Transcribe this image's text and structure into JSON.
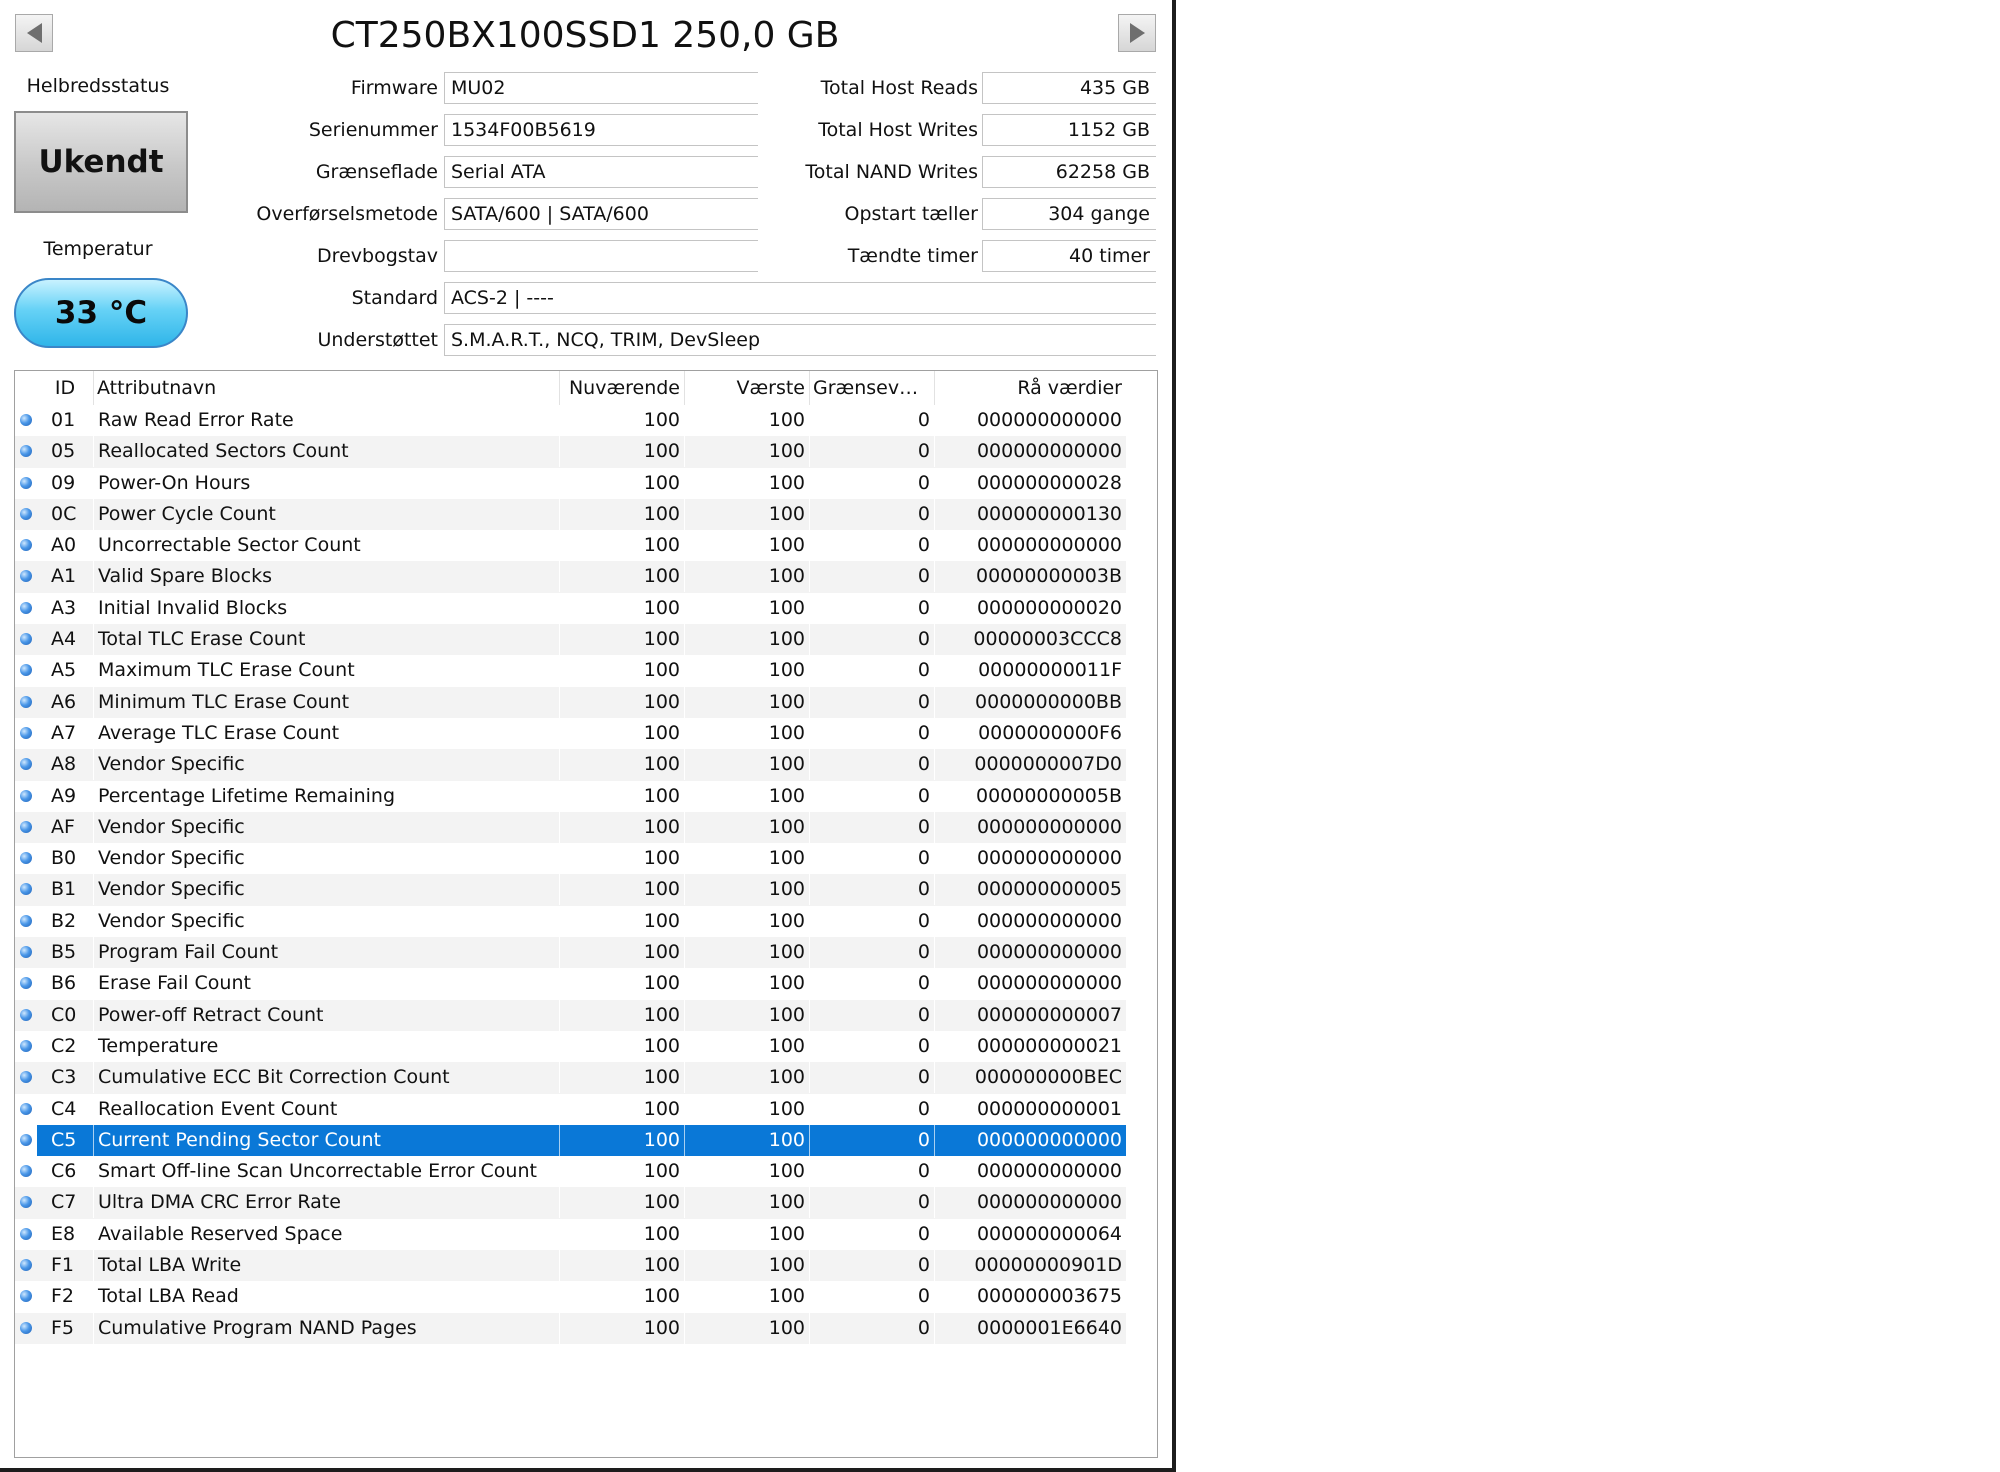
{
  "disk": {
    "title": "CT250BX100SSD1 250,0 GB"
  },
  "status": {
    "health_label": "Helbredsstatus",
    "health_value": "Ukendt",
    "temperature_label": "Temperatur",
    "temperature_value": "33 °C"
  },
  "info_left": [
    {
      "label": "Firmware",
      "value": "MU02"
    },
    {
      "label": "Serienummer",
      "value": "1534F00B5619"
    },
    {
      "label": "Grænseflade",
      "value": "Serial ATA"
    },
    {
      "label": "Overførselsmetode",
      "value": "SATA/600 | SATA/600"
    },
    {
      "label": "Drevbogstav",
      "value": ""
    },
    {
      "label": "Standard",
      "value": "ACS-2 | ----"
    },
    {
      "label": "Understøttet",
      "value": "S.M.A.R.T., NCQ, TRIM, DevSleep"
    }
  ],
  "info_right": [
    {
      "label": "Total Host Reads",
      "value": "435 GB"
    },
    {
      "label": "Total Host Writes",
      "value": "1152 GB"
    },
    {
      "label": "Total NAND Writes",
      "value": "62258 GB"
    },
    {
      "label": "Opstart tæller",
      "value": "304 gange"
    },
    {
      "label": "Tændte timer",
      "value": "40 timer"
    }
  ],
  "table": {
    "headers": {
      "id": "ID",
      "name": "Attributnavn",
      "current": "Nuværende",
      "worst": "Værste",
      "threshold": "Grænseværdi",
      "raw": "Rå værdier"
    },
    "rows": [
      {
        "id": "01",
        "name": "Raw Read Error Rate",
        "current": "100",
        "worst": "100",
        "threshold": "0",
        "raw": "000000000000"
      },
      {
        "id": "05",
        "name": "Reallocated Sectors Count",
        "current": "100",
        "worst": "100",
        "threshold": "0",
        "raw": "000000000000"
      },
      {
        "id": "09",
        "name": "Power-On Hours",
        "current": "100",
        "worst": "100",
        "threshold": "0",
        "raw": "000000000028"
      },
      {
        "id": "0C",
        "name": "Power Cycle Count",
        "current": "100",
        "worst": "100",
        "threshold": "0",
        "raw": "000000000130"
      },
      {
        "id": "A0",
        "name": "Uncorrectable Sector Count",
        "current": "100",
        "worst": "100",
        "threshold": "0",
        "raw": "000000000000"
      },
      {
        "id": "A1",
        "name": "Valid Spare Blocks",
        "current": "100",
        "worst": "100",
        "threshold": "0",
        "raw": "00000000003B"
      },
      {
        "id": "A3",
        "name": "Initial Invalid Blocks",
        "current": "100",
        "worst": "100",
        "threshold": "0",
        "raw": "000000000020"
      },
      {
        "id": "A4",
        "name": "Total TLC Erase Count",
        "current": "100",
        "worst": "100",
        "threshold": "0",
        "raw": "00000003CCC8"
      },
      {
        "id": "A5",
        "name": "Maximum TLC Erase Count",
        "current": "100",
        "worst": "100",
        "threshold": "0",
        "raw": "00000000011F"
      },
      {
        "id": "A6",
        "name": "Minimum TLC Erase Count",
        "current": "100",
        "worst": "100",
        "threshold": "0",
        "raw": "0000000000BB"
      },
      {
        "id": "A7",
        "name": "Average TLC Erase Count",
        "current": "100",
        "worst": "100",
        "threshold": "0",
        "raw": "0000000000F6"
      },
      {
        "id": "A8",
        "name": "Vendor Specific",
        "current": "100",
        "worst": "100",
        "threshold": "0",
        "raw": "0000000007D0"
      },
      {
        "id": "A9",
        "name": "Percentage Lifetime Remaining",
        "current": "100",
        "worst": "100",
        "threshold": "0",
        "raw": "00000000005B"
      },
      {
        "id": "AF",
        "name": "Vendor Specific",
        "current": "100",
        "worst": "100",
        "threshold": "0",
        "raw": "000000000000"
      },
      {
        "id": "B0",
        "name": "Vendor Specific",
        "current": "100",
        "worst": "100",
        "threshold": "0",
        "raw": "000000000000"
      },
      {
        "id": "B1",
        "name": "Vendor Specific",
        "current": "100",
        "worst": "100",
        "threshold": "0",
        "raw": "000000000005"
      },
      {
        "id": "B2",
        "name": "Vendor Specific",
        "current": "100",
        "worst": "100",
        "threshold": "0",
        "raw": "000000000000"
      },
      {
        "id": "B5",
        "name": "Program Fail Count",
        "current": "100",
        "worst": "100",
        "threshold": "0",
        "raw": "000000000000"
      },
      {
        "id": "B6",
        "name": "Erase Fail Count",
        "current": "100",
        "worst": "100",
        "threshold": "0",
        "raw": "000000000000"
      },
      {
        "id": "C0",
        "name": "Power-off Retract Count",
        "current": "100",
        "worst": "100",
        "threshold": "0",
        "raw": "000000000007"
      },
      {
        "id": "C2",
        "name": "Temperature",
        "current": "100",
        "worst": "100",
        "threshold": "0",
        "raw": "000000000021"
      },
      {
        "id": "C3",
        "name": "Cumulative ECC Bit Correction Count",
        "current": "100",
        "worst": "100",
        "threshold": "0",
        "raw": "000000000BEC"
      },
      {
        "id": "C4",
        "name": "Reallocation Event Count",
        "current": "100",
        "worst": "100",
        "threshold": "0",
        "raw": "000000000001"
      },
      {
        "id": "C5",
        "name": "Current Pending Sector Count",
        "current": "100",
        "worst": "100",
        "threshold": "0",
        "raw": "000000000000",
        "selected": true
      },
      {
        "id": "C6",
        "name": "Smart Off-line Scan Uncorrectable Error Count",
        "current": "100",
        "worst": "100",
        "threshold": "0",
        "raw": "000000000000"
      },
      {
        "id": "C7",
        "name": "Ultra DMA CRC Error Rate",
        "current": "100",
        "worst": "100",
        "threshold": "0",
        "raw": "000000000000"
      },
      {
        "id": "E8",
        "name": "Available Reserved Space",
        "current": "100",
        "worst": "100",
        "threshold": "0",
        "raw": "000000000064"
      },
      {
        "id": "F1",
        "name": "Total LBA Write",
        "current": "100",
        "worst": "100",
        "threshold": "0",
        "raw": "00000000901D"
      },
      {
        "id": "F2",
        "name": "Total LBA Read",
        "current": "100",
        "worst": "100",
        "threshold": "0",
        "raw": "000000003675"
      },
      {
        "id": "F5",
        "name": "Cumulative Program NAND Pages",
        "current": "100",
        "worst": "100",
        "threshold": "0",
        "raw": "0000001E6640"
      }
    ]
  },
  "icons": {
    "prev": "triangle-left-icon",
    "next": "triangle-right-icon",
    "status_dot": "blue-circle-icon"
  },
  "colors": {
    "selection": "#0a78d7",
    "temperature_good": "#2fb5e9",
    "health_unknown": "#bfbfbf"
  }
}
